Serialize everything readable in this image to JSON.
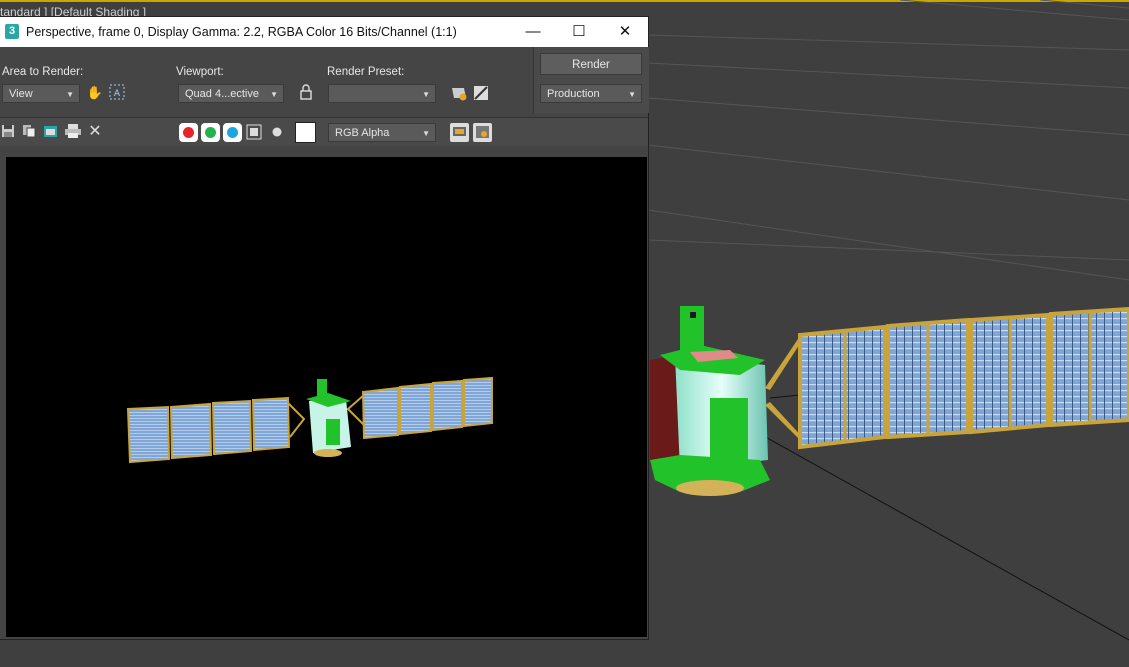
{
  "viewport": {
    "label": "tandard ] [Default Shading ]"
  },
  "frame_window": {
    "app_icon": "3",
    "title": "Perspective, frame 0, Display Gamma: 2.2, RGBA Color 16 Bits/Channel (1:1)",
    "controls": {
      "minimize": "—",
      "maximize": "☐",
      "close": "✕"
    },
    "settings": {
      "area_label": "Area to Render:",
      "area_value": "View",
      "viewport_label": "Viewport:",
      "viewport_value": "Quad 4...ective",
      "preset_label": "Render Preset:",
      "preset_value": "",
      "render_button": "Render",
      "production_value": "Production"
    },
    "toolbar": {
      "channel_display": "RGB Alpha"
    },
    "channel_colors": {
      "red": "#e8232a",
      "green": "#22b34a",
      "blue": "#1aa7e0"
    }
  }
}
